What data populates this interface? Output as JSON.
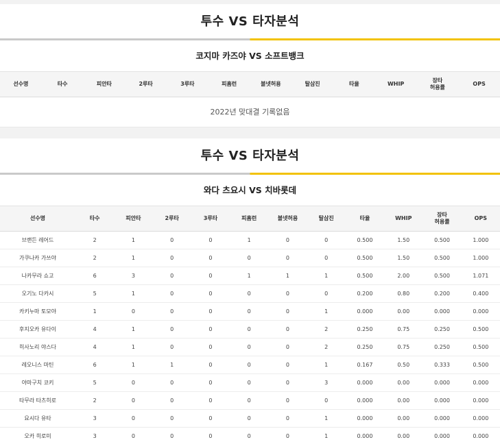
{
  "sections": [
    {
      "title": "투수 VS 타자분석",
      "matchup": "코지마 카즈야 VS 소프트뱅크",
      "columns": [
        "선수명",
        "타수",
        "피안타",
        "2루타",
        "3루타",
        "피홈런",
        "볼넷허용",
        "탈삼진",
        "타율",
        "WHIP",
        "장타\n허용률",
        "OPS"
      ],
      "empty_text": "2022년 맞대결 기록없음"
    },
    {
      "title": "투수 VS 타자분석",
      "matchup": "와다 츠요시 VS 치바롯데",
      "columns": [
        "선수명",
        "타수",
        "피안타",
        "2루타",
        "3루타",
        "피홈런",
        "볼넷허용",
        "탈삼진",
        "타율",
        "WHIP",
        "장타\n허용률",
        "OPS"
      ],
      "rows": [
        [
          "브랜든 레어드",
          "2",
          "1",
          "0",
          "0",
          "1",
          "0",
          "0",
          "0.500",
          "1.50",
          "0.500",
          "1.000"
        ],
        [
          "가쿠나카 가쓰야",
          "2",
          "1",
          "0",
          "0",
          "0",
          "0",
          "0",
          "0.500",
          "1.50",
          "0.500",
          "1.000"
        ],
        [
          "나카무라 쇼고",
          "6",
          "3",
          "0",
          "0",
          "1",
          "1",
          "1",
          "0.500",
          "2.00",
          "0.500",
          "1.071"
        ],
        [
          "오기노 다카시",
          "5",
          "1",
          "0",
          "0",
          "0",
          "0",
          "0",
          "0.200",
          "0.80",
          "0.200",
          "0.400"
        ],
        [
          "카키누마 토모야",
          "1",
          "0",
          "0",
          "0",
          "0",
          "0",
          "1",
          "0.000",
          "0.00",
          "0.000",
          "0.000"
        ],
        [
          "후지오카 유다이",
          "4",
          "1",
          "0",
          "0",
          "0",
          "0",
          "2",
          "0.250",
          "0.75",
          "0.250",
          "0.500"
        ],
        [
          "히사노리 야스다",
          "4",
          "1",
          "0",
          "0",
          "0",
          "0",
          "2",
          "0.250",
          "0.75",
          "0.250",
          "0.500"
        ],
        [
          "레오니스 마틴",
          "6",
          "1",
          "1",
          "0",
          "0",
          "0",
          "1",
          "0.167",
          "0.50",
          "0.333",
          "0.500"
        ],
        [
          "야마구치 코키",
          "5",
          "0",
          "0",
          "0",
          "0",
          "0",
          "3",
          "0.000",
          "0.00",
          "0.000",
          "0.000"
        ],
        [
          "타무라 타츠히로",
          "2",
          "0",
          "0",
          "0",
          "0",
          "0",
          "0",
          "0.000",
          "0.00",
          "0.000",
          "0.000"
        ],
        [
          "요시다 유타",
          "3",
          "0",
          "0",
          "0",
          "0",
          "0",
          "1",
          "0.000",
          "0.00",
          "0.000",
          "0.000"
        ],
        [
          "오카 히로미",
          "3",
          "0",
          "0",
          "0",
          "0",
          "0",
          "1",
          "0.000",
          "0.00",
          "0.000",
          "0.000"
        ]
      ]
    }
  ]
}
